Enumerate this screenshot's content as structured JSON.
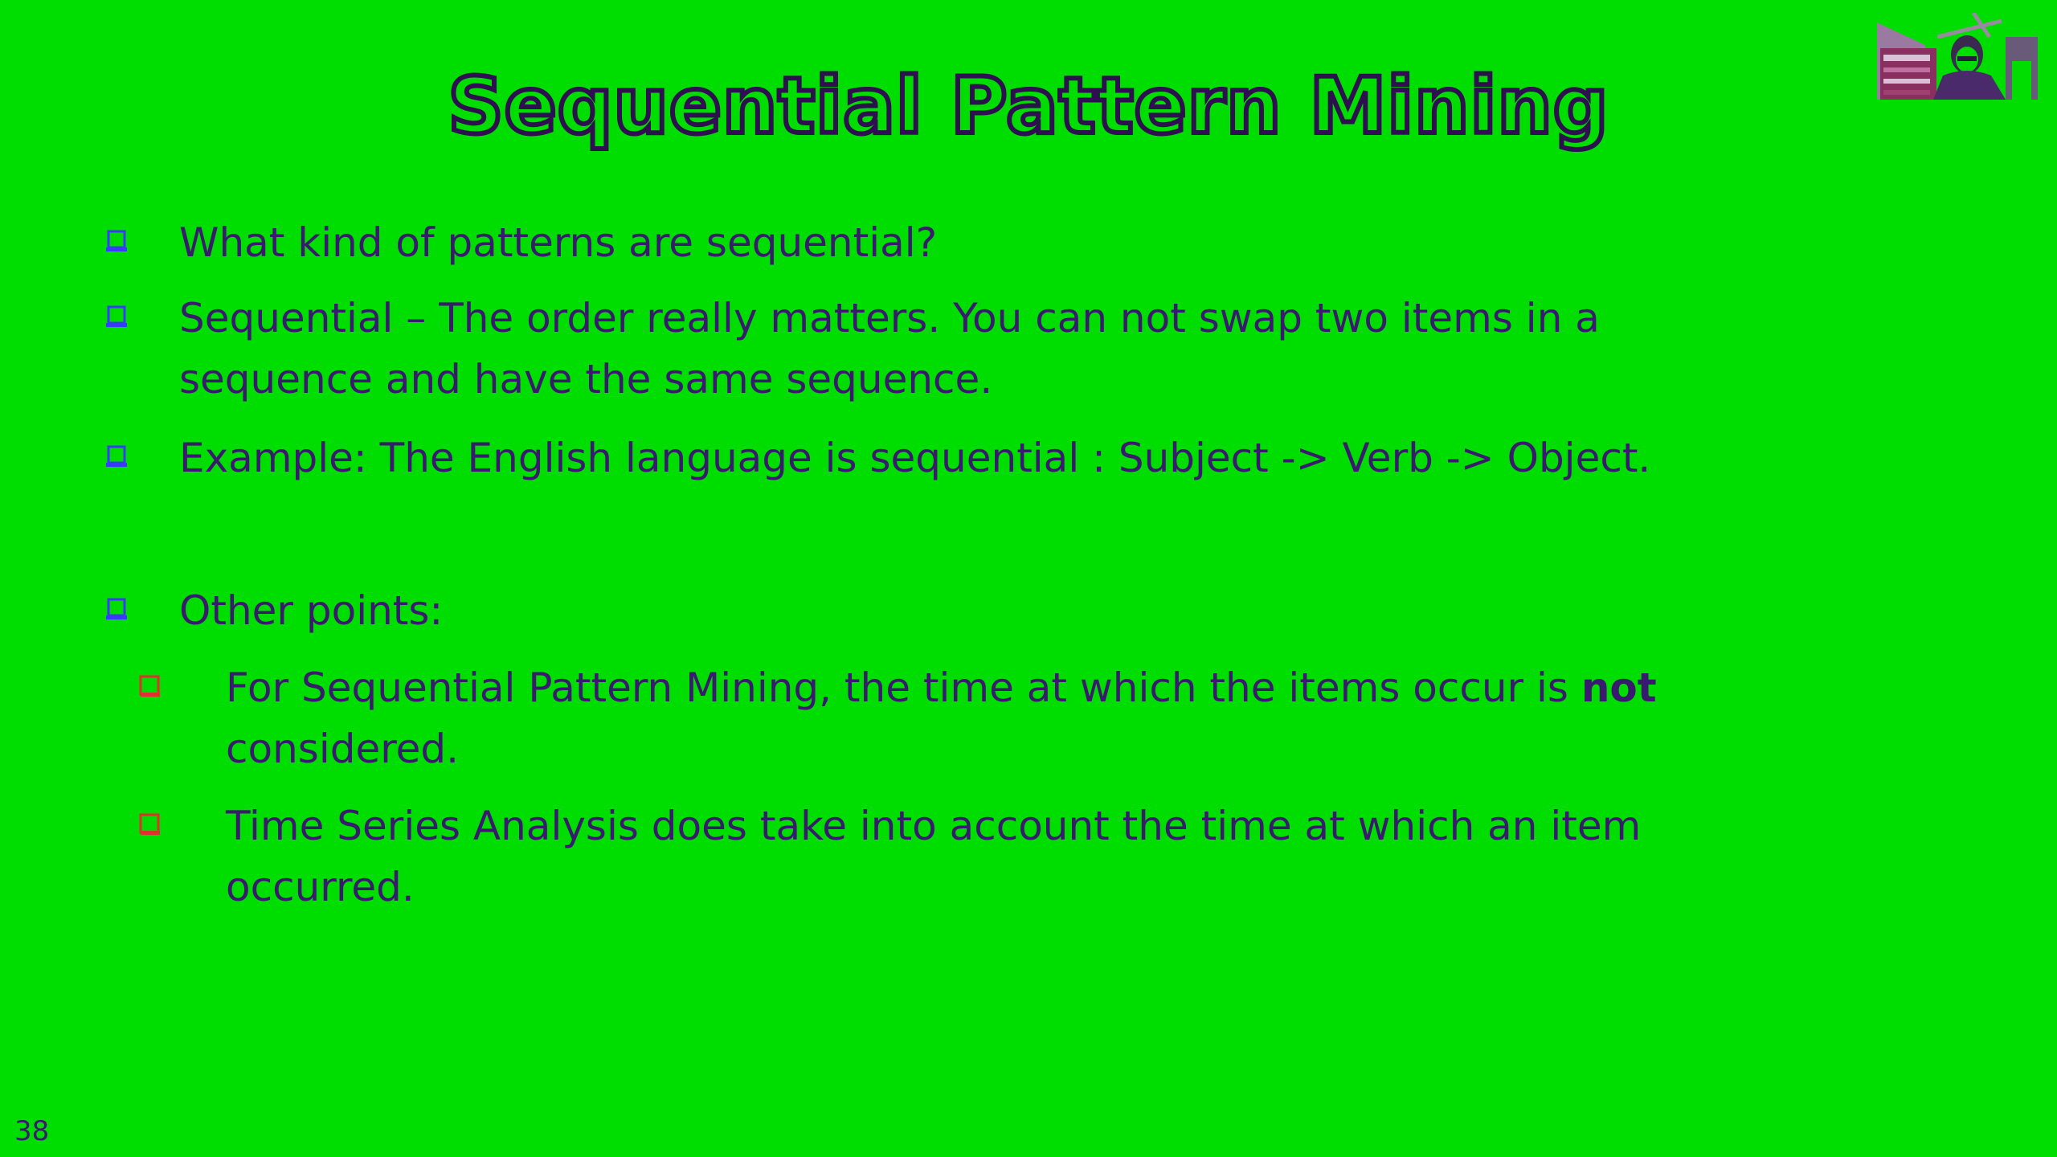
{
  "slide": {
    "title": "Sequential Pattern Mining",
    "bullets": [
      {
        "text": "What kind of patterns are sequential?"
      },
      {
        "text": "Sequential – The order really matters.  You can not swap two items in a sequence and have the same sequence."
      },
      {
        "text": "Example: The English language is sequential : Subject -> Verb -> Object."
      },
      {
        "text": "Other points:"
      }
    ],
    "sub_bullets": [
      {
        "text_before": "For Sequential Pattern Mining, the time at which the items occur is ",
        "text_emph": "not",
        "text_after": " considered."
      },
      {
        "text": "Time Series Analysis does take into account the time at which an item occurred."
      }
    ],
    "slide_number": "38"
  },
  "colors": {
    "background": "#00dd00",
    "text": "#3a1a6e",
    "title_outline": "#2e0f4f",
    "bullet_level1": "#3a3aff",
    "bullet_level2": "#e03030"
  },
  "icons": {
    "bullet_level1": "square-bullet-icon",
    "bullet_level2": "square-bullet-icon",
    "webcam": "presenter-webcam-thumbnail"
  }
}
